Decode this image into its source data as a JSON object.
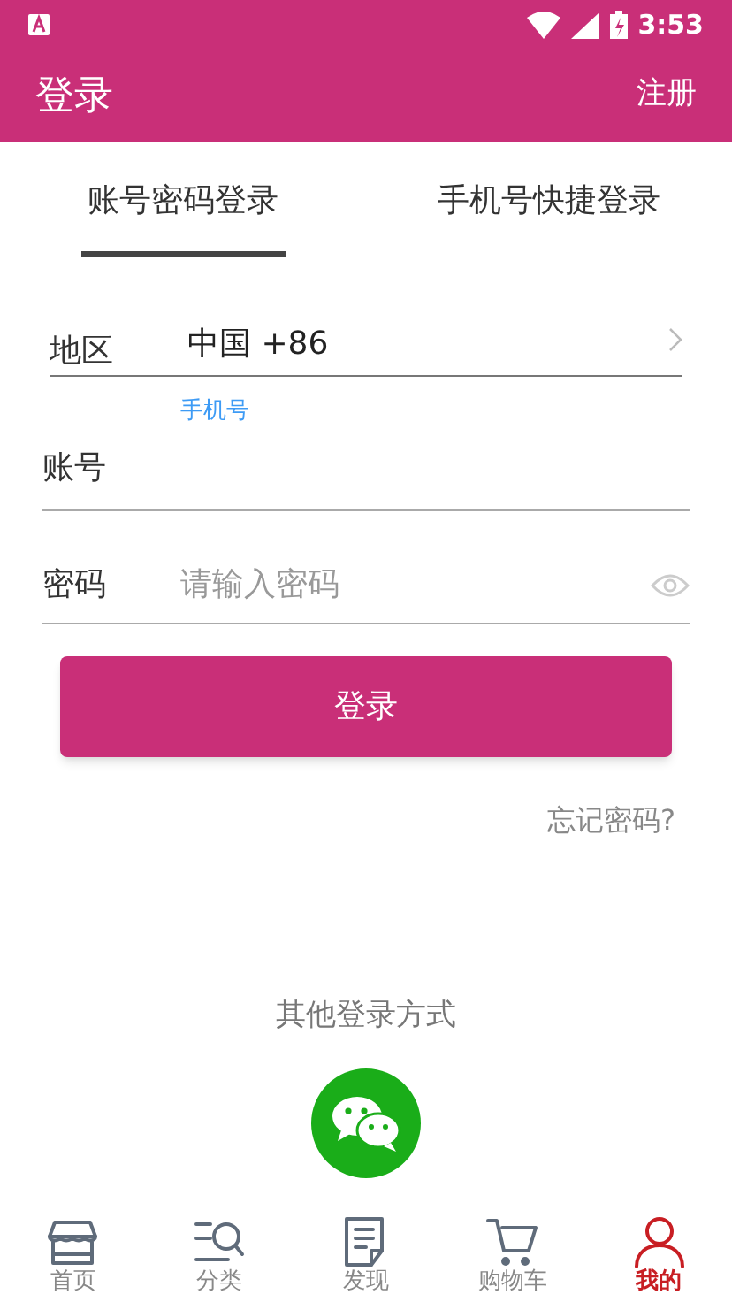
{
  "status_bar": {
    "time": "3:53"
  },
  "header": {
    "title": "登录",
    "action": "注册"
  },
  "tabs": [
    {
      "label": "账号密码登录",
      "selected": true
    },
    {
      "label": "手机号快捷登录",
      "selected": false
    }
  ],
  "form": {
    "region": {
      "label": "地区",
      "value": "中国 +86"
    },
    "account": {
      "label": "账号",
      "floating_label": "手机号"
    },
    "password": {
      "label": "密码",
      "placeholder": "请输入密码"
    }
  },
  "login_button": "登录",
  "forgot": "忘记密码?",
  "other_login": "其他登录方式",
  "nav": [
    {
      "label": "首页",
      "kind": "store",
      "selected": false
    },
    {
      "label": "分类",
      "kind": "category",
      "selected": false
    },
    {
      "label": "发现",
      "kind": "discover",
      "selected": false
    },
    {
      "label": "购物车",
      "kind": "cart",
      "selected": false
    },
    {
      "label": "我的",
      "kind": "user",
      "selected": true
    }
  ]
}
